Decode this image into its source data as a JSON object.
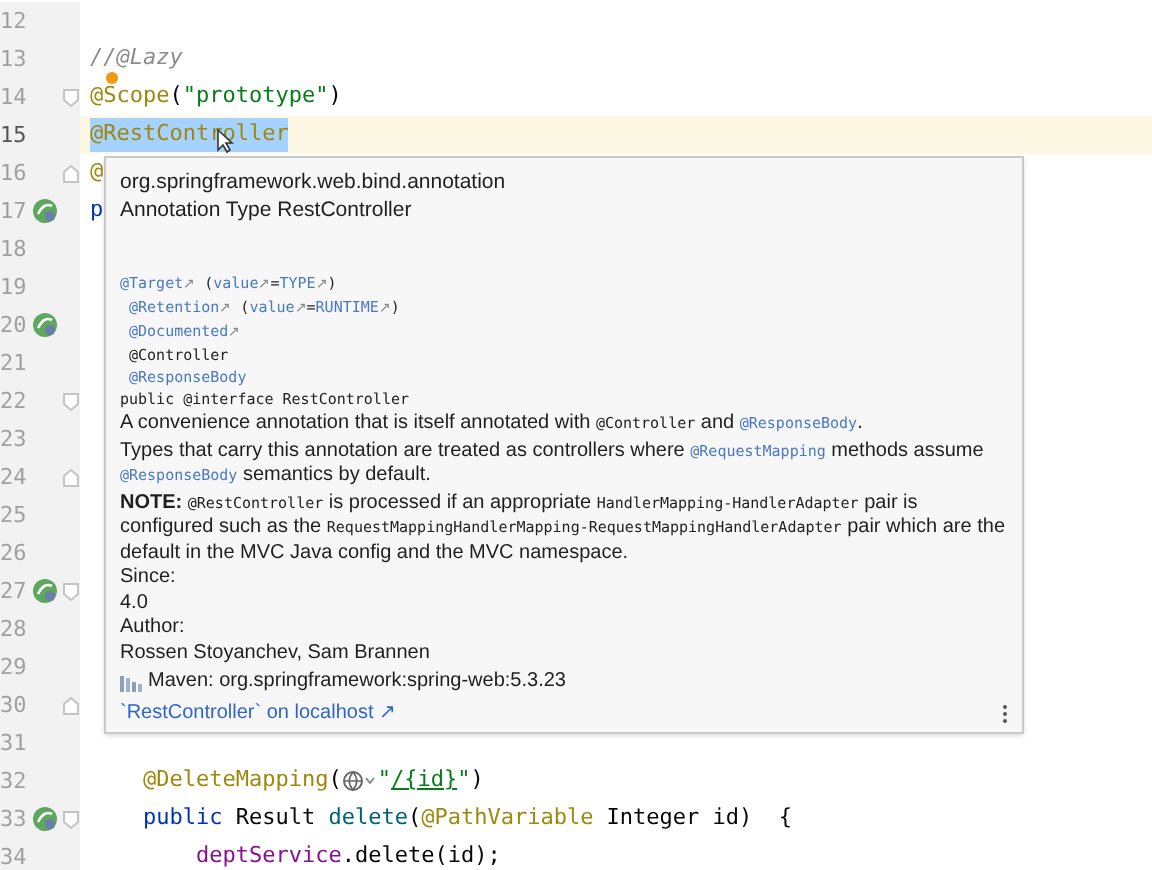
{
  "editor": {
    "lines": [
      {
        "number": "12",
        "current": false
      },
      {
        "number": "13",
        "current": false,
        "tokens": [
          {
            "text": "//@Lazy",
            "kind": "comment"
          }
        ]
      },
      {
        "number": "14",
        "current": false,
        "bulb": true,
        "fold_start": true,
        "tokens": [
          {
            "text": "@Scope",
            "kind": "annotation"
          },
          {
            "text": "(",
            "kind": "plain"
          },
          {
            "text": "\"prototype\"",
            "kind": "string"
          },
          {
            "text": ")",
            "kind": "plain"
          }
        ]
      },
      {
        "number": "15",
        "current": true,
        "tokens": [
          {
            "text": "@RestController",
            "kind": "annotation-selected"
          }
        ]
      },
      {
        "number": "16",
        "current": false,
        "fold_end": true,
        "tokens": [
          {
            "text": "@",
            "kind": "annotation"
          }
        ]
      },
      {
        "number": "17",
        "current": false,
        "bean": true,
        "tokens": [
          {
            "text": "p",
            "kind": "keyword"
          }
        ]
      },
      {
        "number": "18",
        "current": false
      },
      {
        "number": "19",
        "current": false
      },
      {
        "number": "20",
        "current": false,
        "bean": true
      },
      {
        "number": "21",
        "current": false
      },
      {
        "number": "22",
        "current": false,
        "fold_start": true
      },
      {
        "number": "23",
        "current": false
      },
      {
        "number": "24",
        "current": false,
        "fold_end": true
      },
      {
        "number": "25",
        "current": false
      },
      {
        "number": "26",
        "current": false
      },
      {
        "number": "27",
        "current": false,
        "bean": true,
        "fold_start": true
      },
      {
        "number": "28",
        "current": false
      },
      {
        "number": "29",
        "current": false
      },
      {
        "number": "30",
        "current": false,
        "fold_end": true
      },
      {
        "number": "31",
        "current": false
      },
      {
        "number": "32",
        "current": false,
        "tokens": [
          {
            "text": "    @DeleteMapping",
            "kind": "annotation"
          },
          {
            "text": "(",
            "kind": "plain"
          },
          {
            "kind": "globe"
          },
          {
            "text": "\"",
            "kind": "string"
          },
          {
            "text": "/{id}",
            "kind": "url"
          },
          {
            "text": "\"",
            "kind": "string"
          },
          {
            "text": ")",
            "kind": "plain"
          }
        ]
      },
      {
        "number": "33",
        "current": false,
        "bean": true,
        "fold_start": true,
        "tokens": [
          {
            "text": "    public",
            "kind": "keyword"
          },
          {
            "text": " Result ",
            "kind": "plain"
          },
          {
            "text": "delete",
            "kind": "method"
          },
          {
            "text": "(",
            "kind": "plain"
          },
          {
            "text": "@PathVariable",
            "kind": "annotation"
          },
          {
            "text": " Integer id)  {",
            "kind": "plain"
          }
        ]
      },
      {
        "number": "34",
        "current": false,
        "tokens": [
          {
            "text": "        deptService",
            "kind": "field"
          },
          {
            "text": ".delete(id);",
            "kind": "plain"
          }
        ]
      }
    ]
  },
  "doc_popup": {
    "package": "org.springframework.web.bind.annotation",
    "heading": "Annotation Type RestController",
    "signature": [
      [
        {
          "text": "@Target",
          "kind": "link"
        },
        {
          "text": "↗",
          "kind": "arrow"
        },
        {
          "text": " (",
          "kind": "code"
        },
        {
          "text": "value",
          "kind": "link"
        },
        {
          "text": "↗",
          "kind": "arrow"
        },
        {
          "text": "=",
          "kind": "code"
        },
        {
          "text": "TYPE",
          "kind": "link"
        },
        {
          "text": "↗",
          "kind": "arrow"
        },
        {
          "text": ")",
          "kind": "code"
        }
      ],
      [
        {
          "text": " @Retention",
          "kind": "link"
        },
        {
          "text": "↗",
          "kind": "arrow"
        },
        {
          "text": " (",
          "kind": "code"
        },
        {
          "text": "value",
          "kind": "link"
        },
        {
          "text": "↗",
          "kind": "arrow"
        },
        {
          "text": "=",
          "kind": "code"
        },
        {
          "text": "RUNTIME",
          "kind": "link"
        },
        {
          "text": "↗",
          "kind": "arrow"
        },
        {
          "text": ")",
          "kind": "code"
        }
      ],
      [
        {
          "text": " @Documented",
          "kind": "link"
        },
        {
          "text": "↗",
          "kind": "arrow"
        }
      ],
      [
        {
          "text": " @Controller",
          "kind": "code"
        }
      ],
      [
        {
          "text": " @ResponseBody",
          "kind": "link"
        }
      ],
      [
        {
          "text": "public @interface RestController",
          "kind": "code"
        }
      ]
    ],
    "description": [
      [
        {
          "text": "A convenience annotation that is itself annotated with ",
          "kind": "text"
        },
        {
          "text": "@Controller",
          "kind": "code"
        },
        {
          "text": " and ",
          "kind": "text"
        },
        {
          "text": "@ResponseBody",
          "kind": "link"
        },
        {
          "text": ".",
          "kind": "text"
        }
      ],
      [
        {
          "text": "Types that carry this annotation are treated as controllers where ",
          "kind": "text"
        },
        {
          "text": "@RequestMapping",
          "kind": "link"
        },
        {
          "text": " methods assume ",
          "kind": "text"
        },
        {
          "text": "@ResponseBody",
          "kind": "link"
        },
        {
          "text": " semantics by default.",
          "kind": "text"
        }
      ],
      [
        {
          "text": "NOTE: ",
          "kind": "bold"
        },
        {
          "text": "@RestController",
          "kind": "code"
        },
        {
          "text": " is processed if an appropriate ",
          "kind": "text"
        },
        {
          "text": "HandlerMapping-HandlerAdapter",
          "kind": "code"
        },
        {
          "text": " pair is configured such as the ",
          "kind": "text"
        },
        {
          "text": "RequestMappingHandlerMapping-RequestMappingHandlerAdapter",
          "kind": "code"
        },
        {
          "text": " pair which are the default in the MVC Java config and the MVC namespace.",
          "kind": "text"
        }
      ]
    ],
    "sections": [
      {
        "label": "Since:",
        "value": "4.0"
      },
      {
        "label": "Author:",
        "value": "Rossen Stoyanchev, Sam Brannen"
      }
    ],
    "library": "Maven: org.springframework:spring-web:5.3.23",
    "footer_link": "`RestController` on localhost ↗"
  }
}
